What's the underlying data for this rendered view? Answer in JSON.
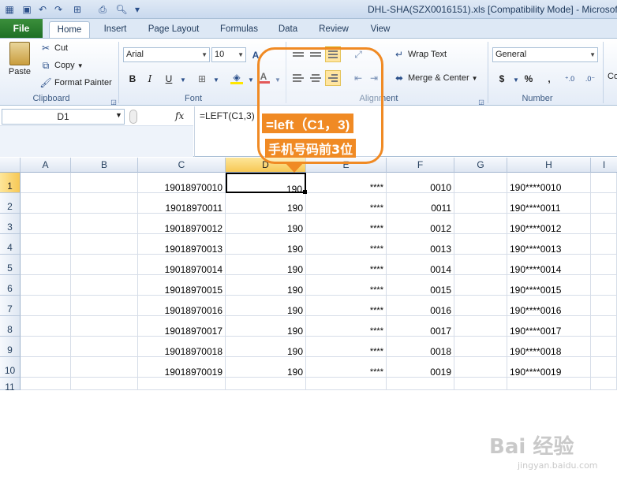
{
  "window": {
    "title": "DHL-SHA(SZX0016151).xls  [Compatibility Mode] - Microsof"
  },
  "tabs": [
    "File",
    "Home",
    "Insert",
    "Page Layout",
    "Formulas",
    "Data",
    "Review",
    "View"
  ],
  "ribbon": {
    "clipboard": {
      "label": "Clipboard",
      "paste": "Paste",
      "cut": "Cut",
      "copy": "Copy",
      "format_painter": "Format Painter"
    },
    "font": {
      "label": "Font",
      "name": "Arial",
      "size": "10",
      "bold": "B",
      "italic": "I",
      "underline": "U",
      "font_color_glyph": "A"
    },
    "alignment": {
      "label": "Alignment",
      "wrap_text": "Wrap Text",
      "merge_center": "Merge & Center"
    },
    "number": {
      "label": "Number",
      "format": "General",
      "currency": "$",
      "percent": "%",
      "comma": ","
    },
    "styles_partial": "Co"
  },
  "formula_bar": {
    "name_box": "D1",
    "fx": "fx",
    "formula": "=LEFT(C1,3)"
  },
  "grid": {
    "columns": [
      "A",
      "B",
      "C",
      "D",
      "E",
      "F",
      "G",
      "H",
      "I"
    ],
    "selected_column": "D",
    "rows": [
      {
        "row": "1",
        "C": "19018970010",
        "D": "190",
        "E": "****",
        "F": "0010",
        "H": "190****0010"
      },
      {
        "row": "2",
        "C": "19018970011",
        "D": "190",
        "E": "****",
        "F": "0011",
        "H": "190****0011"
      },
      {
        "row": "3",
        "C": "19018970012",
        "D": "190",
        "E": "****",
        "F": "0012",
        "H": "190****0012"
      },
      {
        "row": "4",
        "C": "19018970013",
        "D": "190",
        "E": "****",
        "F": "0013",
        "H": "190****0013"
      },
      {
        "row": "5",
        "C": "19018970014",
        "D": "190",
        "E": "****",
        "F": "0014",
        "H": "190****0014"
      },
      {
        "row": "6",
        "C": "19018970015",
        "D": "190",
        "E": "****",
        "F": "0015",
        "H": "190****0015"
      },
      {
        "row": "7",
        "C": "19018970016",
        "D": "190",
        "E": "****",
        "F": "0016",
        "H": "190****0016"
      },
      {
        "row": "8",
        "C": "19018970017",
        "D": "190",
        "E": "****",
        "F": "0017",
        "H": "190****0017"
      },
      {
        "row": "9",
        "C": "19018970018",
        "D": "190",
        "E": "****",
        "F": "0018",
        "H": "190****0018"
      },
      {
        "row": "10",
        "C": "19018970019",
        "D": "190",
        "E": "****",
        "F": "0019",
        "H": "190****0019"
      },
      {
        "row": "11"
      }
    ]
  },
  "callout": {
    "line1": "=left（C1，3)",
    "line2": "手机号码前3位",
    "color": "#f08a24"
  },
  "watermark": {
    "text": "Bai 经验",
    "sub": "jingyan.baidu.com"
  }
}
